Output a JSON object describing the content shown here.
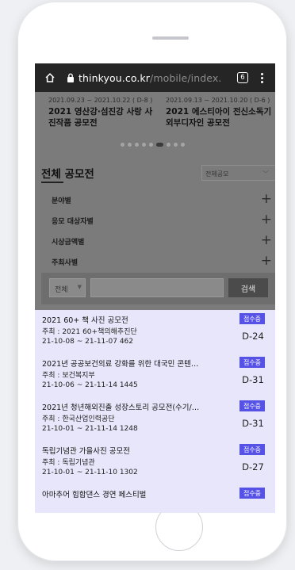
{
  "browser": {
    "url_domain": "thinkyou.co.kr",
    "url_path": "/mobile/index.",
    "tab_count": "6"
  },
  "carousel": {
    "cards": [
      {
        "date": "2021.09.23 ~ 2021.10.22 ( D-8 )",
        "title": "2021 영산강·섬진강 사랑 사진작품 공모전"
      },
      {
        "date": "2021.09.13 ~ 2021.10.20 ( D-6 )",
        "title": "2021 에스티아이 전신소독기 외부디자인 공모전"
      }
    ]
  },
  "section": {
    "title": "전체 공모전",
    "select_value": "전체공모",
    "filters": [
      "분야별",
      "응모 대상자별",
      "시상금액별",
      "주최사별"
    ]
  },
  "search": {
    "scope": "전체",
    "button": "검색"
  },
  "contests": [
    {
      "title": "2021 60+ 책 사진 공모전",
      "host": "주최 : 2021 60+책의해추진단",
      "meta": "21-10-08 ~ 21-11-07   462",
      "status": "접수중",
      "dday": "D-24"
    },
    {
      "title": "2021년 공공보건의료 강화를 위한 대국민 콘텐…",
      "host": "주최 : 보건복지부",
      "meta": "21-10-06 ~ 21-11-14   1445",
      "status": "접수중",
      "dday": "D-31"
    },
    {
      "title": "2021년 청년해외진출 성장스토리 공모전(수기/…",
      "host": "주최 : 한국산업인력공단",
      "meta": "21-10-01 ~ 21-11-14   1248",
      "status": "접수중",
      "dday": "D-31"
    },
    {
      "title": "독립기념관 가을사진 공모전",
      "host": "주최 : 독립기념관",
      "meta": "21-10-01 ~ 21-11-10   1302",
      "status": "접수중",
      "dday": "D-27"
    },
    {
      "title": "아마추어 힙합댄스 경연 페스티벌",
      "host": "",
      "meta": "",
      "status": "접수중",
      "dday": ""
    }
  ]
}
